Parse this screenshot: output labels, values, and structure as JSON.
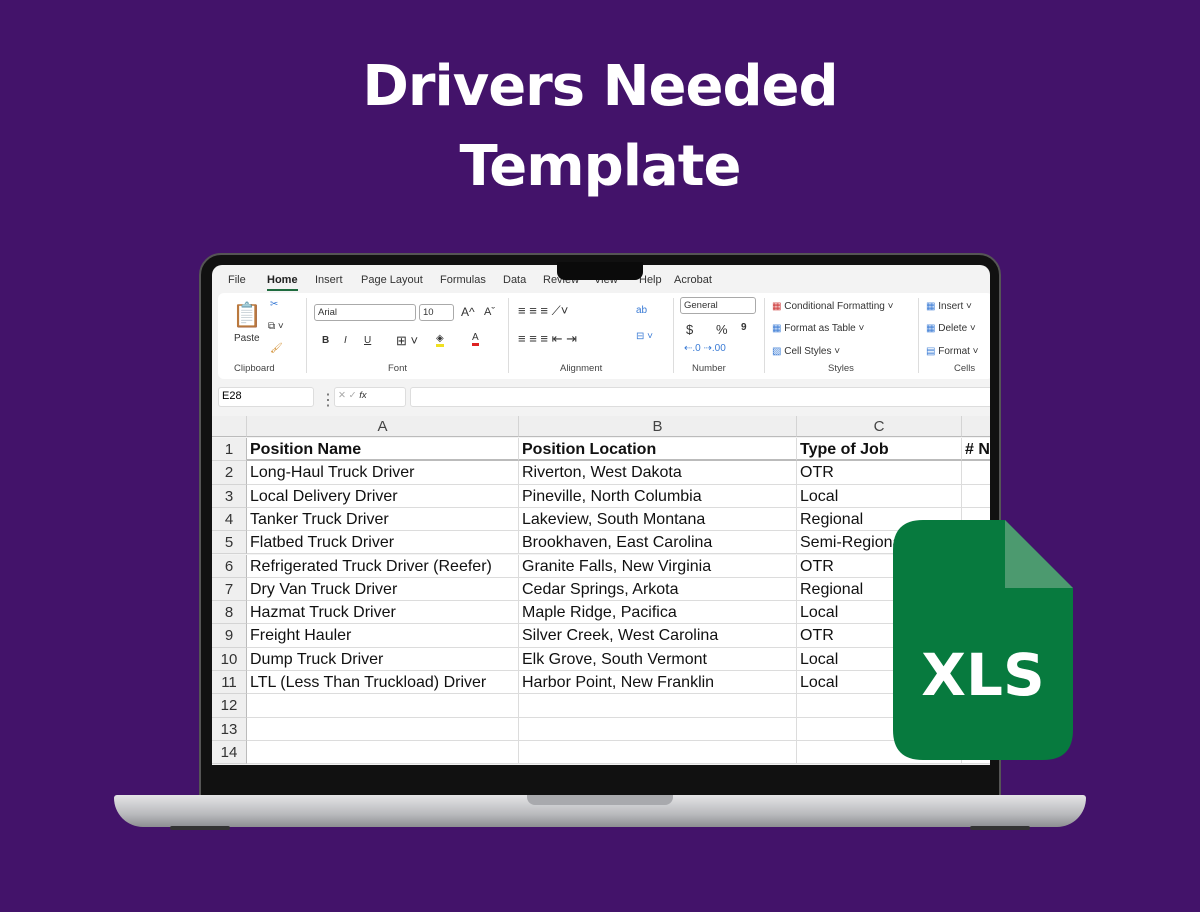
{
  "title": {
    "line1": "Drivers Needed",
    "line2": "Template"
  },
  "colors": {
    "background": "#43136a",
    "excel_green": "#077a3e",
    "fold": "#4c9a6f"
  },
  "menu_tabs": [
    "File",
    "Home",
    "Insert",
    "Page Layout",
    "Formulas",
    "Data",
    "Review",
    "View",
    "Help",
    "Acrobat"
  ],
  "active_tab": "Home",
  "ribbon": {
    "clipboard": {
      "paste": "Paste",
      "label": "Clipboard"
    },
    "font": {
      "name": "Arial",
      "size": "10",
      "bold": "B",
      "italic": "I",
      "underline": "U",
      "grow": "A^",
      "shrink": "Aˇ",
      "label": "Font"
    },
    "alignment": {
      "label": "Alignment"
    },
    "number": {
      "format": "General",
      "currency": "$",
      "percent": "%",
      "comma": "9",
      "label": "Number"
    },
    "styles": {
      "conditional": "Conditional Formatting",
      "format_table": "Format as Table",
      "cell_styles": "Cell Styles",
      "label": "Styles"
    },
    "cells": {
      "insert": "Insert",
      "delete": "Delete",
      "format": "Format",
      "label": "Cells"
    }
  },
  "formula_bar": {
    "name_box": "E28",
    "fx": "fx",
    "value": ""
  },
  "sheet": {
    "columns": [
      "A",
      "B",
      "C"
    ],
    "headers": [
      "Position Name",
      "Position Location",
      "Type of Job",
      "# N"
    ],
    "rows": [
      [
        "Long-Haul Truck Driver",
        "Riverton, West Dakota",
        "OTR"
      ],
      [
        "Local Delivery Driver",
        "Pineville, North Columbia",
        "Local"
      ],
      [
        "Tanker Truck Driver",
        "Lakeview, South Montana",
        "Regional"
      ],
      [
        "Flatbed Truck Driver",
        "Brookhaven, East Carolina",
        "Semi-Regional"
      ],
      [
        "Refrigerated Truck Driver (Reefer)",
        "Granite Falls, New Virginia",
        "OTR"
      ],
      [
        "Dry Van Truck Driver",
        "Cedar Springs, Arkota",
        "Regional"
      ],
      [
        "Hazmat Truck Driver",
        "Maple Ridge, Pacifica",
        "Local"
      ],
      [
        "Freight Hauler",
        "Silver Creek, West Carolina",
        "OTR"
      ],
      [
        "Dump Truck Driver",
        "Elk Grove, South Vermont",
        "Local"
      ],
      [
        "LTL (Less Than Truckload) Driver",
        "Harbor Point, New Franklin",
        "Local"
      ]
    ],
    "row_numbers": [
      "1",
      "2",
      "3",
      "4",
      "5",
      "6",
      "7",
      "8",
      "9",
      "10",
      "11",
      "12",
      "13",
      "14"
    ]
  },
  "badge": {
    "text": "XLS"
  }
}
